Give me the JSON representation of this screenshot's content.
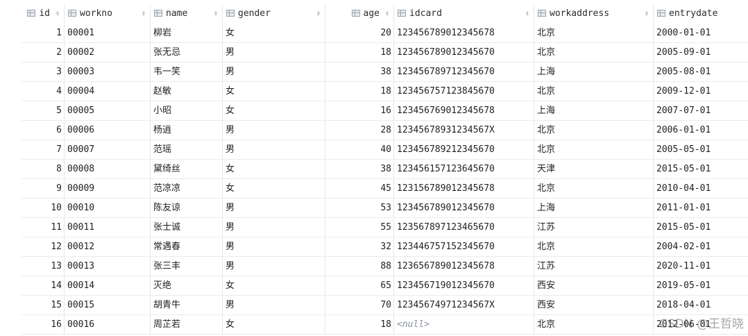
{
  "table": {
    "columns": [
      {
        "key": "id",
        "label": "id",
        "icon": "column-icon"
      },
      {
        "key": "workno",
        "label": "workno",
        "icon": "column-icon"
      },
      {
        "key": "name",
        "label": "name",
        "icon": "column-icon"
      },
      {
        "key": "gender",
        "label": "gender",
        "icon": "column-icon"
      },
      {
        "key": "age",
        "label": "age",
        "icon": "column-icon"
      },
      {
        "key": "idcard",
        "label": "idcard",
        "icon": "column-icon"
      },
      {
        "key": "workaddress",
        "label": "workaddress",
        "icon": "column-icon"
      },
      {
        "key": "entrydate",
        "label": "entrydate",
        "icon": "column-icon"
      }
    ],
    "sort_glyph": "⇕",
    "rows": [
      {
        "id": "1",
        "workno": "00001",
        "name": "柳岩",
        "gender": "女",
        "age": "20",
        "idcard": "123456789012345678",
        "workaddress": "北京",
        "entrydate": "2000-01-01"
      },
      {
        "id": "2",
        "workno": "00002",
        "name": "张无忌",
        "gender": "男",
        "age": "18",
        "idcard": "123456789012345670",
        "workaddress": "北京",
        "entrydate": "2005-09-01"
      },
      {
        "id": "3",
        "workno": "00003",
        "name": "韦一笑",
        "gender": "男",
        "age": "38",
        "idcard": "123456789712345670",
        "workaddress": "上海",
        "entrydate": "2005-08-01"
      },
      {
        "id": "4",
        "workno": "00004",
        "name": "赵敏",
        "gender": "女",
        "age": "18",
        "idcard": "123456757123845670",
        "workaddress": "北京",
        "entrydate": "2009-12-01"
      },
      {
        "id": "5",
        "workno": "00005",
        "name": "小昭",
        "gender": "女",
        "age": "16",
        "idcard": "123456769012345678",
        "workaddress": "上海",
        "entrydate": "2007-07-01"
      },
      {
        "id": "6",
        "workno": "00006",
        "name": "杨逍",
        "gender": "男",
        "age": "28",
        "idcard": "12345678931234567X",
        "workaddress": "北京",
        "entrydate": "2006-01-01"
      },
      {
        "id": "7",
        "workno": "00007",
        "name": "范瑶",
        "gender": "男",
        "age": "40",
        "idcard": "123456789212345670",
        "workaddress": "北京",
        "entrydate": "2005-05-01"
      },
      {
        "id": "8",
        "workno": "00008",
        "name": "黛绮丝",
        "gender": "女",
        "age": "38",
        "idcard": "123456157123645670",
        "workaddress": "天津",
        "entrydate": "2015-05-01"
      },
      {
        "id": "9",
        "workno": "00009",
        "name": "范凉凉",
        "gender": "女",
        "age": "45",
        "idcard": "123156789012345678",
        "workaddress": "北京",
        "entrydate": "2010-04-01"
      },
      {
        "id": "10",
        "workno": "00010",
        "name": "陈友谅",
        "gender": "男",
        "age": "53",
        "idcard": "123456789012345670",
        "workaddress": "上海",
        "entrydate": "2011-01-01"
      },
      {
        "id": "11",
        "workno": "00011",
        "name": "张士诚",
        "gender": "男",
        "age": "55",
        "idcard": "123567897123465670",
        "workaddress": "江苏",
        "entrydate": "2015-05-01"
      },
      {
        "id": "12",
        "workno": "00012",
        "name": "常遇春",
        "gender": "男",
        "age": "32",
        "idcard": "123446757152345670",
        "workaddress": "北京",
        "entrydate": "2004-02-01"
      },
      {
        "id": "13",
        "workno": "00013",
        "name": "张三丰",
        "gender": "男",
        "age": "88",
        "idcard": "123656789012345678",
        "workaddress": "江苏",
        "entrydate": "2020-11-01"
      },
      {
        "id": "14",
        "workno": "00014",
        "name": "灭绝",
        "gender": "女",
        "age": "65",
        "idcard": "123456719012345670",
        "workaddress": "西安",
        "entrydate": "2019-05-01"
      },
      {
        "id": "15",
        "workno": "00015",
        "name": "胡青牛",
        "gender": "男",
        "age": "70",
        "idcard": "12345674971234567X",
        "workaddress": "西安",
        "entrydate": "2018-04-01"
      },
      {
        "id": "16",
        "workno": "00016",
        "name": "周芷若",
        "gender": "女",
        "age": "18",
        "idcard": "<null>",
        "workaddress": "北京",
        "entrydate": "2012-06-01"
      }
    ]
  },
  "watermark": "CSDN @王哲晓"
}
